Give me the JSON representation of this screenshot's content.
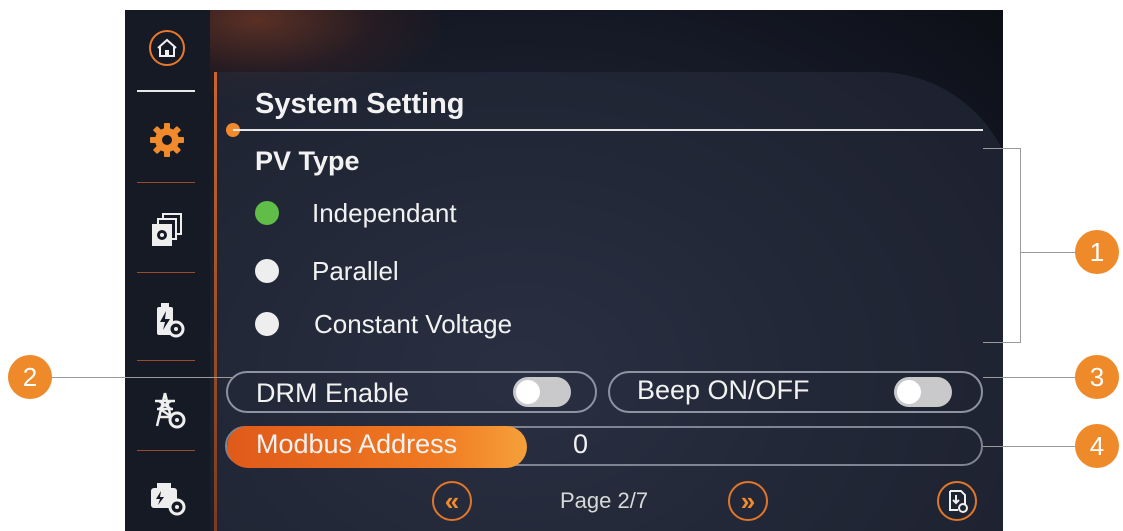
{
  "screen": {
    "title": "System Setting",
    "pv_type": {
      "heading": "PV Type",
      "options": [
        {
          "label": "Independant",
          "selected": true
        },
        {
          "label": "Parallel",
          "selected": false
        },
        {
          "label": "Constant Voltage",
          "selected": false
        }
      ]
    },
    "drm": {
      "label": "DRM Enable",
      "enabled": false
    },
    "beep": {
      "label": "Beep ON/OFF",
      "enabled": false
    },
    "modbus": {
      "label": "Modbus Address",
      "value": "0"
    },
    "pager": {
      "text": "Page 2/7",
      "prev_symbol": "«",
      "next_symbol": "»"
    }
  },
  "sidebar": {
    "items": [
      {
        "icon": "home-icon"
      },
      {
        "icon": "gear-icon",
        "active": true
      },
      {
        "icon": "copy-settings-icon"
      },
      {
        "icon": "battery-settings-icon"
      },
      {
        "icon": "grid-tower-settings-icon"
      },
      {
        "icon": "generator-settings-icon"
      }
    ]
  },
  "callouts": [
    "1",
    "2",
    "3",
    "4"
  ],
  "colors": {
    "accent": "#f08a2c",
    "active_radio": "#5fbd48",
    "background": "#1c2130"
  }
}
